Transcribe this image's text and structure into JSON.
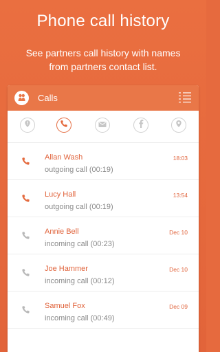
{
  "promo": {
    "title": "Phone call history",
    "subtitle_line1": "See partners call history with names",
    "subtitle_line2": "from partners contact list."
  },
  "app": {
    "title": "Calls",
    "accent_color": "#e66a3e",
    "tabs": [
      {
        "icon": "location-pin-alert-icon",
        "active": false
      },
      {
        "icon": "phone-icon",
        "active": true
      },
      {
        "icon": "message-icon",
        "active": false
      },
      {
        "icon": "facebook-icon",
        "active": false
      },
      {
        "icon": "map-pin-icon",
        "active": false
      }
    ]
  },
  "calls": [
    {
      "name": "Allan Wash",
      "detail": "outgoing call (00:19)",
      "time": "18:03",
      "direction": "outgoing"
    },
    {
      "name": "Lucy Hall",
      "detail": "outgoing call (00:19)",
      "time": "13:54",
      "direction": "outgoing"
    },
    {
      "name": "Annie Bell",
      "detail": "incoming call (00:23)",
      "time": "Dec 10",
      "direction": "incoming"
    },
    {
      "name": "Joe Hammer",
      "detail": "incoming call (00:12)",
      "time": "Dec 10",
      "direction": "incoming"
    },
    {
      "name": "Samuel Fox",
      "detail": "incoming call (00:49)",
      "time": "Dec 09",
      "direction": "incoming"
    }
  ]
}
